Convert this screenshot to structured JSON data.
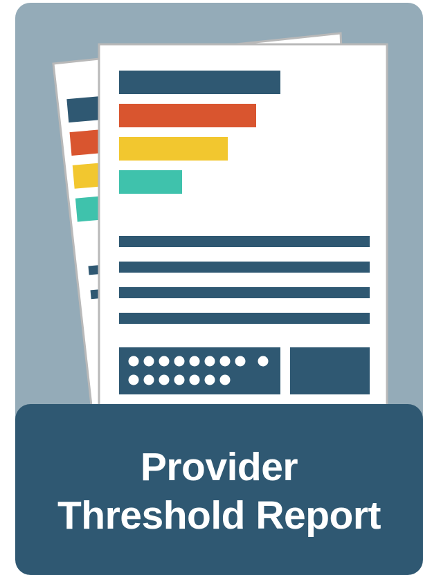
{
  "tile": {
    "title_line_1": "Provider",
    "title_line_2": "Threshold Report"
  },
  "colors": {
    "tile_background": "#94abb8",
    "title_bar": "#2f5872",
    "paper": "#ffffff",
    "paper_border": "#b9b9b9",
    "navy": "#2f5872",
    "orange": "#d9552f",
    "yellow": "#f2c72f",
    "teal": "#3fc2ac"
  },
  "icons": [
    "report-document-icon",
    "bar-chart-icon",
    "text-lines-icon",
    "dots-icon"
  ]
}
